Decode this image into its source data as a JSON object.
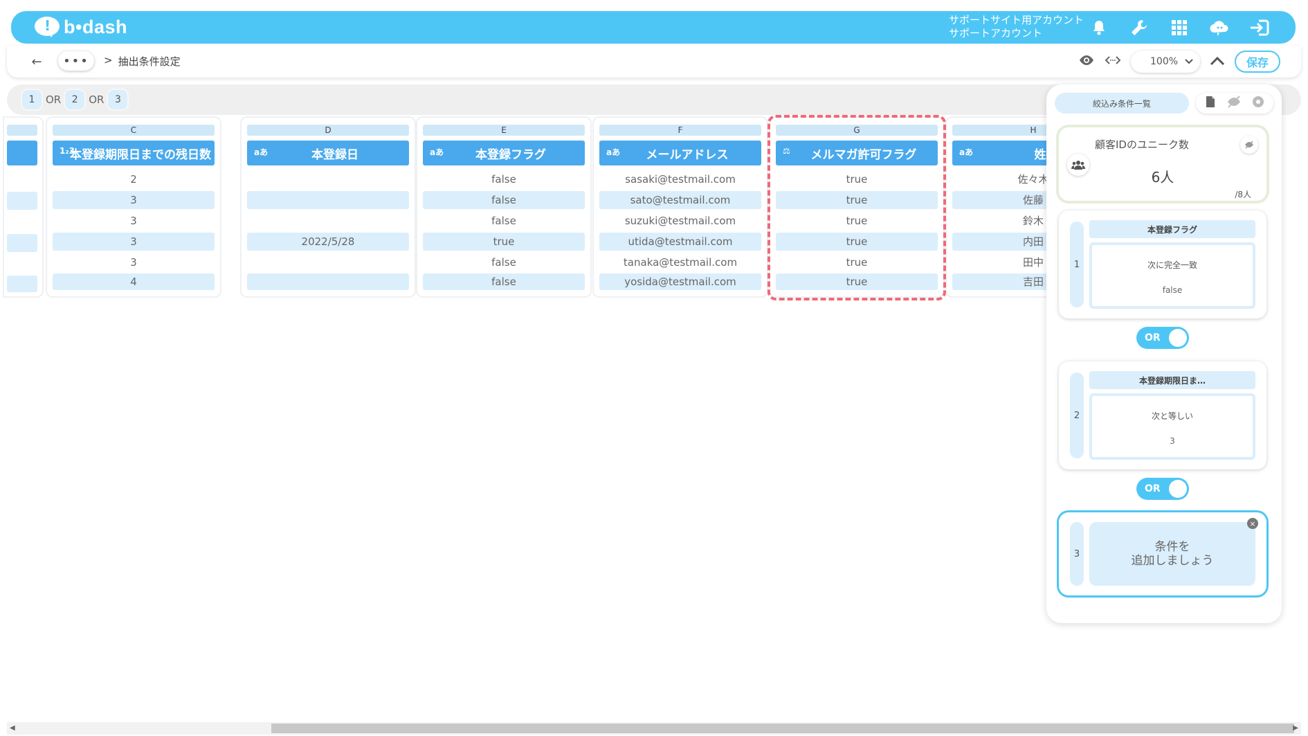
{
  "header": {
    "logo_text": "b•dash",
    "account_line1": "サポートサイト用アカウント",
    "account_line2": "サポートアカウント",
    "icons": [
      "bell-icon",
      "wrench-icon",
      "grid-icon",
      "cloud-icon",
      "logout-icon"
    ]
  },
  "toolbar": {
    "more_label": "•••",
    "breadcrumb_sep": ">",
    "breadcrumb_current": "抽出条件設定",
    "zoom_value": "100%",
    "save_label": "保存"
  },
  "chips": {
    "items": [
      "1",
      "2",
      "3"
    ],
    "joiner": "OR"
  },
  "columns": [
    {
      "letter": "C",
      "type": "1₂3",
      "title": "本登録期限日までの残日数",
      "cells": [
        "2",
        "3",
        "3",
        "3",
        "3",
        "4"
      ]
    },
    {
      "letter": "D",
      "type": "aあ",
      "title": "本登録日",
      "cells": [
        "",
        "",
        "",
        "2022/5/28",
        "",
        ""
      ]
    },
    {
      "letter": "E",
      "type": "aあ",
      "title": "本登録フラグ",
      "cells": [
        "false",
        "false",
        "false",
        "true",
        "false",
        "false"
      ]
    },
    {
      "letter": "F",
      "type": "aあ",
      "title": "メールアドレス",
      "cells": [
        "sasaki@testmail.com",
        "sato@testmail.com",
        "suzuki@testmail.com",
        "utida@testmail.com",
        "tanaka@testmail.com",
        "yosida@testmail.com"
      ]
    },
    {
      "letter": "G",
      "type": "⚖",
      "title": "メルマガ許可フラグ",
      "cells": [
        "true",
        "true",
        "true",
        "true",
        "true",
        "true"
      ]
    },
    {
      "letter": "H",
      "type": "aあ",
      "title": "姓",
      "cells": [
        "佐々木",
        "佐藤",
        "鈴木",
        "内田",
        "田中",
        "吉田"
      ]
    }
  ],
  "panel": {
    "title": "絞込み条件一覧",
    "unique_label": "顧客IDのユニーク数",
    "unique_value": "6人",
    "unique_total": "/8人",
    "conditions": [
      {
        "num": "1",
        "field": "本登録フラグ",
        "op": "次に完全一致",
        "value": "false"
      },
      {
        "num": "2",
        "field": "本登録期限日ま…",
        "op": "次と等しい",
        "value": "3"
      }
    ],
    "or_label": "OR",
    "add_num": "3",
    "add_line1": "条件を",
    "add_line2": "追加しましょう"
  },
  "colors": {
    "brand": "#4ec6f5",
    "header_cell": "#4aa9ec",
    "row_alt": "#dbeefb",
    "highlight_dash": "#ee6a7a"
  }
}
